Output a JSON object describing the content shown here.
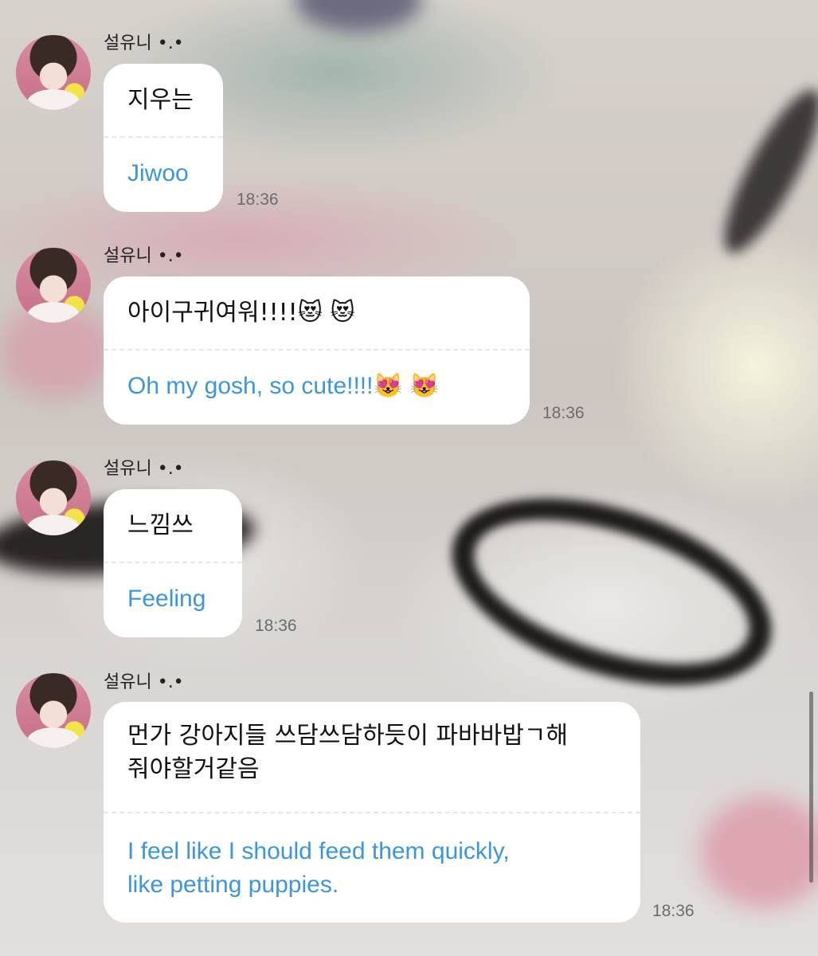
{
  "messages": [
    {
      "sender": "설유니 •.•",
      "original": "지우는",
      "translation": "Jiwoo",
      "time": "18:36"
    },
    {
      "sender": "설유니 •.•",
      "original": "아이구귀여워!!!!😻 😻",
      "translation": "Oh my gosh, so cute!!!!😻 😻",
      "time": "18:36"
    },
    {
      "sender": "설유니 •.•",
      "original": "느낌쓰",
      "translation": "Feeling",
      "time": "18:36"
    },
    {
      "sender": "설유니 •.•",
      "original": "먼가 강아지들 쓰담쓰담하듯이 파바바밥ㄱ해\n줘야할거같음",
      "translation": "I feel like I should feed them quickly,\nlike petting puppies.",
      "time": "18:36"
    }
  ]
}
